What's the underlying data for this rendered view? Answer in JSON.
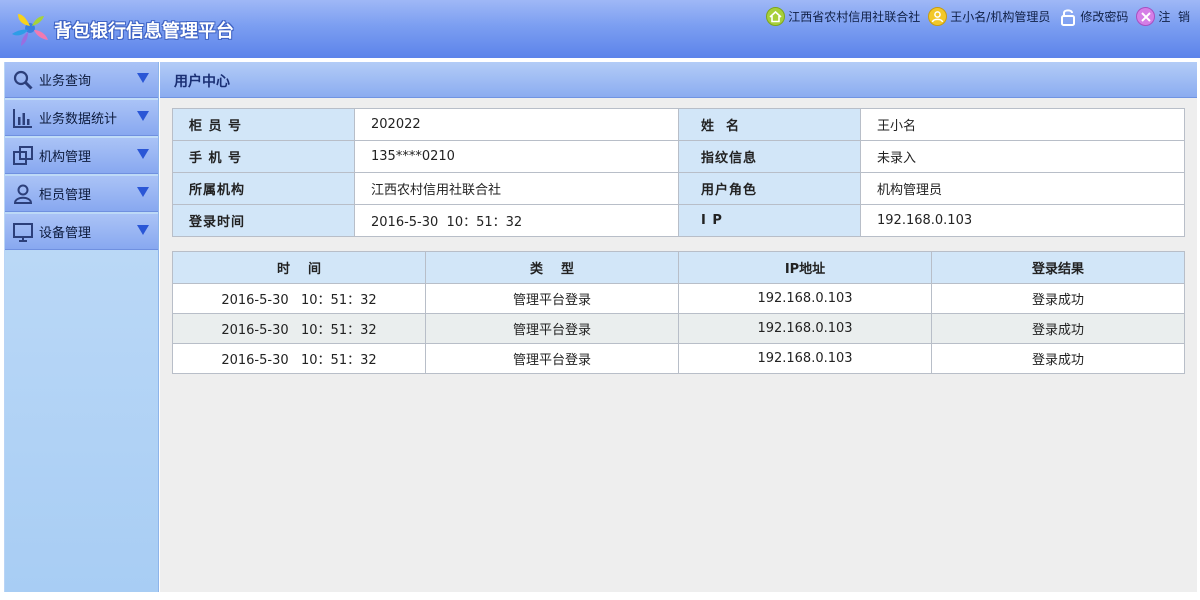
{
  "header": {
    "app_title": "背包银行信息管理平台",
    "links": [
      {
        "icon": "home-icon",
        "label": "江西省农村信用社联合社"
      },
      {
        "icon": "user-icon",
        "label": "王小名/机构管理员"
      },
      {
        "icon": "lock-icon",
        "label": "修改密码"
      },
      {
        "icon": "logout-icon",
        "label": "注  销"
      }
    ]
  },
  "sidebar": {
    "items": [
      {
        "icon": "search-icon",
        "label": "业务查询"
      },
      {
        "icon": "bar-chart-icon",
        "label": "业务数据统计"
      },
      {
        "icon": "organization-icon",
        "label": "机构管理"
      },
      {
        "icon": "teller-icon",
        "label": "柜员管理"
      },
      {
        "icon": "monitor-icon",
        "label": "设备管理"
      }
    ]
  },
  "main": {
    "section_title": "用户中心",
    "profile": [
      {
        "label1": "柜 员 号",
        "value1": "202022",
        "label2": "姓  名",
        "value2": "王小名"
      },
      {
        "label1": "手 机 号",
        "value1": "135****0210",
        "label2": "指纹信息",
        "value2": "未录入"
      },
      {
        "label1": "所属机构",
        "value1": "江西农村信用社联合社",
        "label2": "用户角色",
        "value2": "机构管理员"
      },
      {
        "label1": "登录时间",
        "value1": "2016-5-30  10：51：32",
        "label2": "I P",
        "value2": "192.168.0.103"
      }
    ],
    "log": {
      "headers": [
        "时    间",
        "类    型",
        "IP地址",
        "登录结果"
      ],
      "rows": [
        [
          "2016-5-30   10：51：32",
          "管理平台登录",
          "192.168.0.103",
          "登录成功"
        ],
        [
          "2016-5-30   10：51：32",
          "管理平台登录",
          "192.168.0.103",
          "登录成功"
        ],
        [
          "2016-5-30   10：51：32",
          "管理平台登录",
          "192.168.0.103",
          "登录成功"
        ]
      ]
    }
  },
  "colors": {
    "header": "#7b9ef1",
    "sidebar": "#b6d5f6",
    "nav_item": "#99b6f3",
    "caret": "#2a56d6",
    "label_cell": "#d2e6f8",
    "content_bg": "#eeeeee"
  }
}
